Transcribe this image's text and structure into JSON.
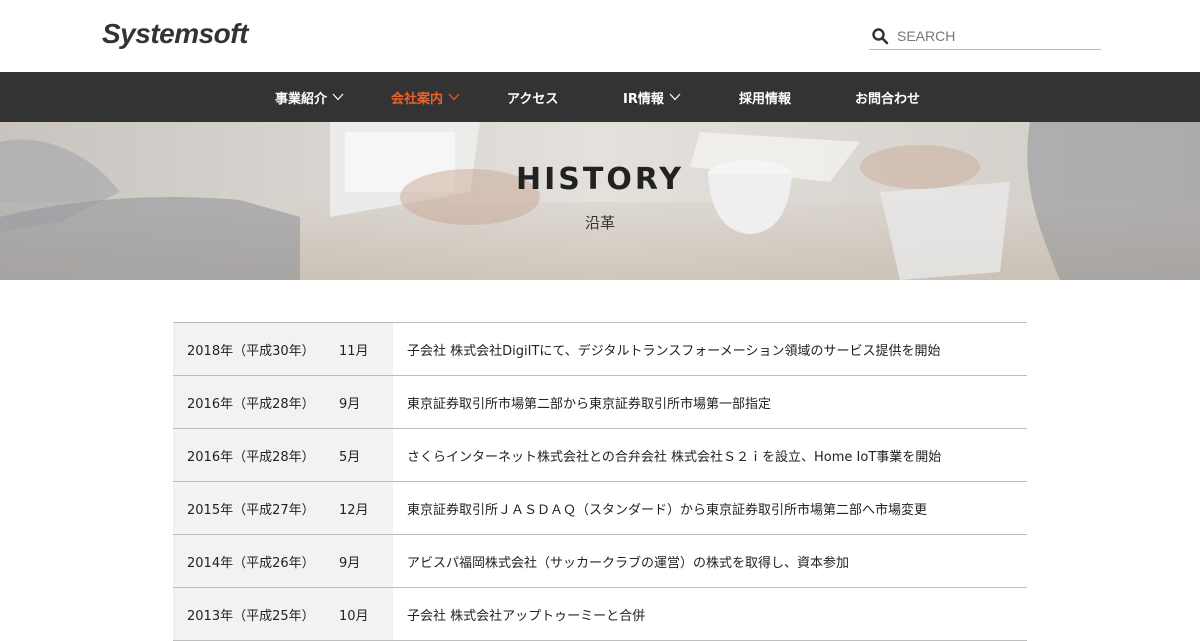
{
  "header": {
    "logo": "Systemsoft",
    "search_placeholder": "SEARCH"
  },
  "nav": {
    "items": [
      {
        "label": "事業紹介",
        "has_dropdown": true,
        "active": false
      },
      {
        "label": "会社案内",
        "has_dropdown": true,
        "active": true
      },
      {
        "label": "アクセス",
        "has_dropdown": false,
        "active": false
      },
      {
        "label": "IR情報",
        "has_dropdown": true,
        "active": false
      },
      {
        "label": "採用情報",
        "has_dropdown": false,
        "active": false
      },
      {
        "label": "お問合わせ",
        "has_dropdown": false,
        "active": false
      }
    ],
    "active_color": "#e8632b",
    "background": "#333333"
  },
  "hero": {
    "title": "HISTORY",
    "subtitle": "沿革"
  },
  "history": {
    "rows": [
      {
        "year": "2018年（平成30年）",
        "month": "11月",
        "desc": "子会社 株式会社DigiITにて、デジタルトランスフォーメーション領域のサービス提供を開始"
      },
      {
        "year": "2016年（平成28年）",
        "month": "9月",
        "desc": "東京証券取引所市場第二部から東京証券取引所市場第一部指定"
      },
      {
        "year": "2016年（平成28年）",
        "month": "5月",
        "desc": "さくらインターネット株式会社との合弁会社 株式会社Ｓ２ｉを設立、Home IoT事業を開始"
      },
      {
        "year": "2015年（平成27年）",
        "month": "12月",
        "desc": "東京証券取引所ＪＡＳＤＡＱ（スタンダード）から東京証券取引所市場第二部へ市場変更"
      },
      {
        "year": "2014年（平成26年）",
        "month": "9月",
        "desc": "アビスパ福岡株式会社（サッカークラブの運営）の株式を取得し、資本参加"
      },
      {
        "year": "2013年（平成25年）",
        "month": "10月",
        "desc": "子会社 株式会社アップトゥーミーと合併"
      }
    ]
  }
}
